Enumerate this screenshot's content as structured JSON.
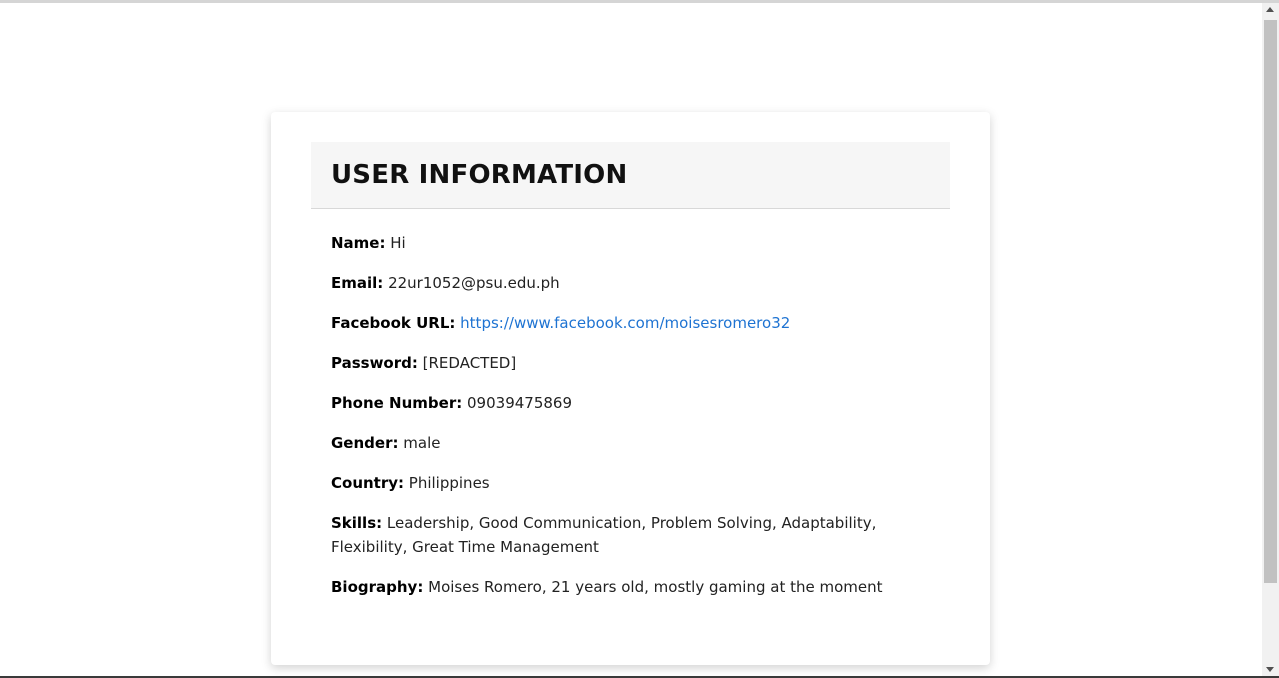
{
  "card": {
    "title": "USER INFORMATION",
    "fields": {
      "name": {
        "label": "Name:",
        "value": "Hi"
      },
      "email": {
        "label": "Email:",
        "value": "22ur1052@psu.edu.ph"
      },
      "facebook": {
        "label": "Facebook URL:",
        "value": "https://www.facebook.com/moisesromero32"
      },
      "password": {
        "label": "Password:",
        "value": "[REDACTED]"
      },
      "phone": {
        "label": "Phone Number:",
        "value": "09039475869"
      },
      "gender": {
        "label": "Gender:",
        "value": "male"
      },
      "country": {
        "label": "Country:",
        "value": "Philippines"
      },
      "skills": {
        "label": "Skills:",
        "value": "Leadership, Good Communication, Problem Solving, Adaptability, Flexibility, Great Time Management"
      },
      "biography": {
        "label": "Biography:",
        "value": "Moises Romero, 21 years old, mostly gaming at the moment"
      }
    }
  },
  "colors": {
    "link": "#1e73d2",
    "header_bg": "#f6f6f6"
  }
}
